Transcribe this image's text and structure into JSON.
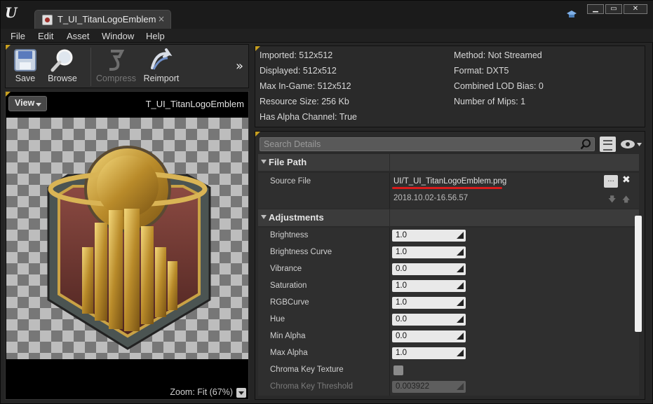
{
  "titlebar": {
    "tab_label": "T_UI_TitanLogoEmblem",
    "tab_close": "×",
    "min": "▁",
    "max": "▭",
    "close": "✕"
  },
  "menu": [
    "File",
    "Edit",
    "Asset",
    "Window",
    "Help"
  ],
  "toolbar": {
    "save": "Save",
    "browse": "Browse",
    "compress": "Compress",
    "reimport": "Reimport",
    "more": "»"
  },
  "viewport": {
    "view_label": "View",
    "asset_name": "T_UI_TitanLogoEmblem",
    "zoom_text": "Zoom: Fit (67%)"
  },
  "info": {
    "imported": "Imported: 512x512",
    "displayed": "Displayed: 512x512",
    "max_in_game": "Max In-Game: 512x512",
    "resource_size": "Resource Size: 256 Kb",
    "has_alpha": "Has Alpha Channel: True",
    "method": "Method: Not Streamed",
    "format": "Format: DXT5",
    "lod_bias": "Combined LOD Bias: 0",
    "mips": "Number of Mips: 1"
  },
  "details": {
    "search_placeholder": "Search Details",
    "file_path_category": "File Path",
    "source_file_label": "Source File",
    "source_file_value": "UI/T_UI_TitanLogoEmblem.png",
    "source_date": "2018.10.02-16.56.57",
    "browse_dots": "...",
    "clear": "✖",
    "down": "🡇",
    "up": "🡅",
    "adjustments_category": "Adjustments",
    "properties": [
      {
        "name": "Brightness",
        "value": "1.0"
      },
      {
        "name": "Brightness Curve",
        "value": "1.0"
      },
      {
        "name": "Vibrance",
        "value": "0.0"
      },
      {
        "name": "Saturation",
        "value": "1.0"
      },
      {
        "name": "RGBCurve",
        "value": "1.0"
      },
      {
        "name": "Hue",
        "value": "0.0"
      },
      {
        "name": "Min Alpha",
        "value": "0.0"
      },
      {
        "name": "Max Alpha",
        "value": "1.0"
      }
    ],
    "chroma_key_texture": "Chroma Key Texture",
    "chroma_key_threshold": "Chroma Key Threshold",
    "chroma_key_threshold_value": "0.003922"
  },
  "icons": {
    "engine_logo": "unreal-logo",
    "hat": "graduation-cap-icon",
    "search": "magnifier-icon",
    "eye": "eye-icon"
  },
  "colors": {
    "accent_corner": "#c8a020",
    "highlight_underline": "#d81c1c"
  }
}
